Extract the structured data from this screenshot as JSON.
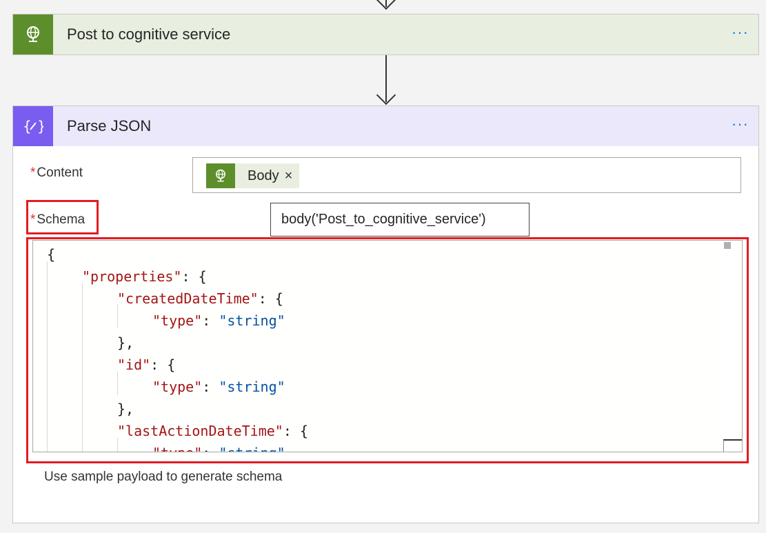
{
  "steps": [
    {
      "title": "Post to cognitive service",
      "more": "···",
      "icon": "globe-icon",
      "color": "#5c8f2b"
    },
    {
      "title": "Parse JSON",
      "more": "···",
      "icon": "curly-braces-icon",
      "color": "#7a5df0"
    }
  ],
  "parse_json": {
    "content_label": "Content",
    "required_marker": "*",
    "schema_label": "Schema",
    "token": {
      "label": "Body",
      "close": "×",
      "icon": "globe-icon"
    },
    "tooltip": "body('Post_to_cognitive_service')",
    "schema_lines": [
      {
        "indent": 0,
        "parts": [
          [
            "p",
            "{"
          ]
        ]
      },
      {
        "indent": 1,
        "parts": [
          [
            "k",
            "\"properties\""
          ],
          [
            "p",
            ": {"
          ]
        ]
      },
      {
        "indent": 2,
        "parts": [
          [
            "k",
            "\"createdDateTime\""
          ],
          [
            "p",
            ": {"
          ]
        ]
      },
      {
        "indent": 3,
        "parts": [
          [
            "k",
            "\"type\""
          ],
          [
            "p",
            ": "
          ],
          [
            "s",
            "\"string\""
          ]
        ]
      },
      {
        "indent": 2,
        "parts": [
          [
            "p",
            "},"
          ]
        ]
      },
      {
        "indent": 2,
        "parts": [
          [
            "k",
            "\"id\""
          ],
          [
            "p",
            ": {"
          ]
        ]
      },
      {
        "indent": 3,
        "parts": [
          [
            "k",
            "\"type\""
          ],
          [
            "p",
            ": "
          ],
          [
            "s",
            "\"string\""
          ]
        ]
      },
      {
        "indent": 2,
        "parts": [
          [
            "p",
            "},"
          ]
        ]
      },
      {
        "indent": 2,
        "parts": [
          [
            "k",
            "\"lastActionDateTime\""
          ],
          [
            "p",
            ": {"
          ]
        ]
      },
      {
        "indent": 3,
        "parts": [
          [
            "k",
            "\"type\""
          ],
          [
            "p",
            ": "
          ],
          [
            "s",
            "\"string\""
          ]
        ]
      }
    ],
    "sample_link": "Use sample payload to generate schema"
  },
  "colors": {
    "highlight": "#e31b23",
    "key": "#a31515",
    "string": "#0451a5",
    "link": "#0078d4"
  }
}
